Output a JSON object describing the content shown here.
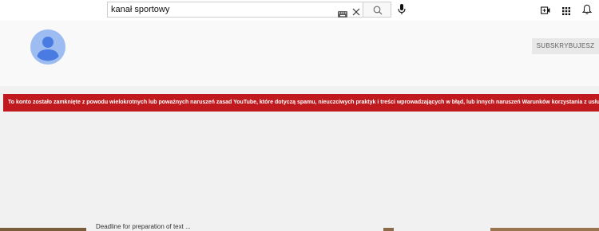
{
  "search": {
    "query": "kanał sportowy"
  },
  "channel": {
    "subscribe_label": "SUBSKRYBUJESZ"
  },
  "banner": {
    "message": "To konto zostało zamknięte z powodu wielokrotnych lub poważnych naruszeń zasad YouTube, które dotyczą spamu, nieuczciwych praktyk i treści wprowadzających w błąd, lub innych naruszeń Warunków korzystania z usługi."
  },
  "bottom": {
    "partial_text": "Deadline for preparation of text ..."
  },
  "icons": {
    "keyboard": "keyboard-icon",
    "clear": "close-icon",
    "search": "search-icon",
    "mic": "microphone-icon",
    "create": "create-video-icon",
    "apps": "apps-grid-icon",
    "notifications": "bell-icon"
  },
  "colors": {
    "banner_bg": "#c0191e",
    "avatar_bg": "#9dbcf2",
    "avatar_fg": "#4a7be0"
  }
}
